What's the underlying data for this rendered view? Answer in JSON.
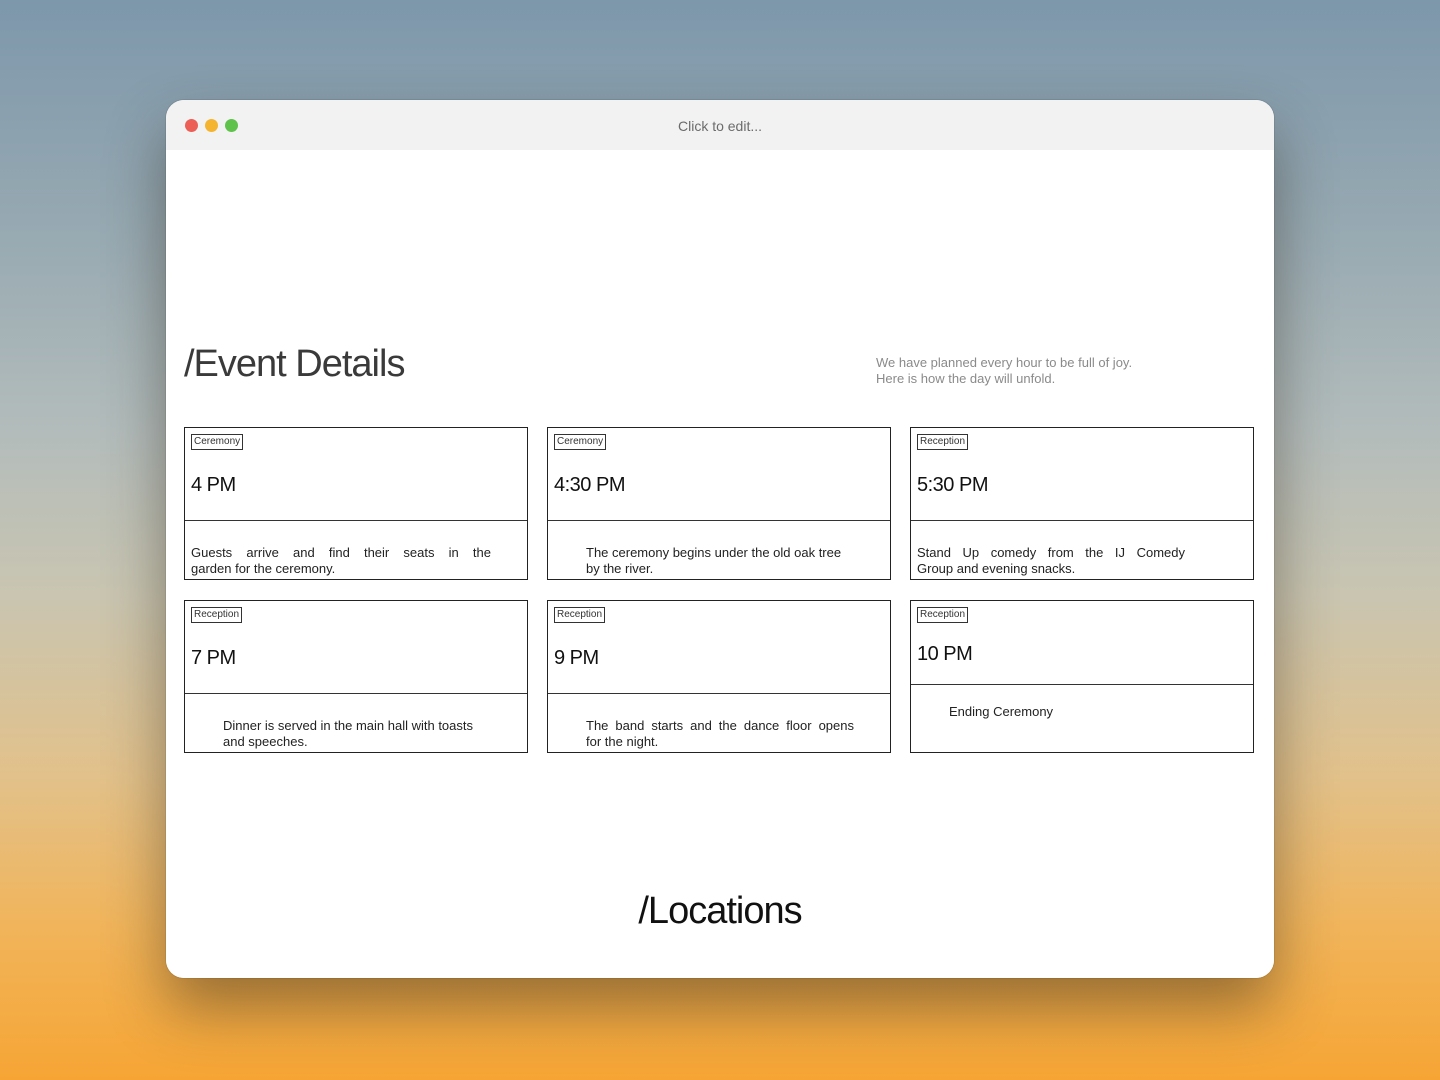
{
  "window": {
    "title": "Click to edit..."
  },
  "event_details": {
    "heading": "/Event Details",
    "intro_line1": "We have planned every hour to be full of joy.",
    "intro_line2": "Here is how the day will unfold."
  },
  "events": [
    {
      "tag": "Ceremony",
      "time": "4 PM",
      "desc_line1": "Guests arrive and find their seats in the",
      "desc_line2": "garden for the ceremony."
    },
    {
      "tag": "Ceremony",
      "time": "4:30 PM",
      "desc_line1": "The ceremony begins under the old oak tree",
      "desc_line2": "by the river."
    },
    {
      "tag": "Reception",
      "time": "5:30 PM",
      "desc_line1": "Stand Up comedy from the IJ Comedy",
      "desc_line2": "Group and evening snacks."
    },
    {
      "tag": "Reception",
      "time": "7 PM",
      "desc_line1": "Dinner is served in the main hall with toasts",
      "desc_line2": "and speeches."
    },
    {
      "tag": "Reception",
      "time": "9 PM",
      "desc_line1": "The band starts and the dance floor opens",
      "desc_line2": "for the night."
    },
    {
      "tag": "Reception",
      "time": "10 PM",
      "desc_line1": "Ending Ceremony",
      "desc_line2": ""
    }
  ],
  "locations": {
    "heading": "/Locations"
  },
  "colors": {
    "traffic_red": "#ec5f57",
    "traffic_yellow": "#f4b42f",
    "traffic_green": "#5fc24b"
  }
}
